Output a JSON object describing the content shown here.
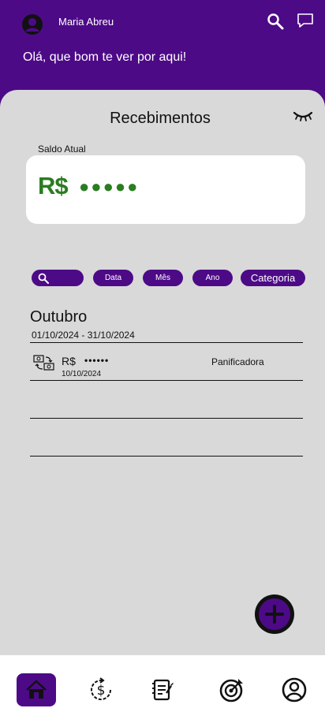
{
  "header": {
    "user_name": "Maria Abreu",
    "greeting": "Olá, que bom te ver por aqui!",
    "icons": [
      "avatar-icon",
      "search-icon",
      "chat-icon"
    ],
    "background_color": "#4d0a87"
  },
  "page": {
    "title": "Recebimentos",
    "visibility_icon": "eye-closed-icon"
  },
  "balance": {
    "label": "Saldo Atual",
    "currency": "R$",
    "masked_value": "●●●●●",
    "color": "#2a7d20"
  },
  "filters": {
    "search_icon": "search-icon",
    "chips": [
      "Data",
      "Mês",
      "Ano",
      "Categoria"
    ]
  },
  "month_group": {
    "name": "Outubro",
    "range": "01/10/2024 - 31/10/2024"
  },
  "transactions": [
    {
      "icon": "money-transfer-icon",
      "currency": "R$",
      "masked_value": "••••••",
      "date": "10/10/2024",
      "category": "Panificadora"
    }
  ],
  "fab": {
    "icon": "plus-icon"
  },
  "bottom_nav": {
    "items": [
      "home-icon",
      "money-cycle-icon",
      "notes-icon",
      "goal-target-icon",
      "profile-icon"
    ],
    "active": "home-icon",
    "active_color": "#4d0a87"
  }
}
